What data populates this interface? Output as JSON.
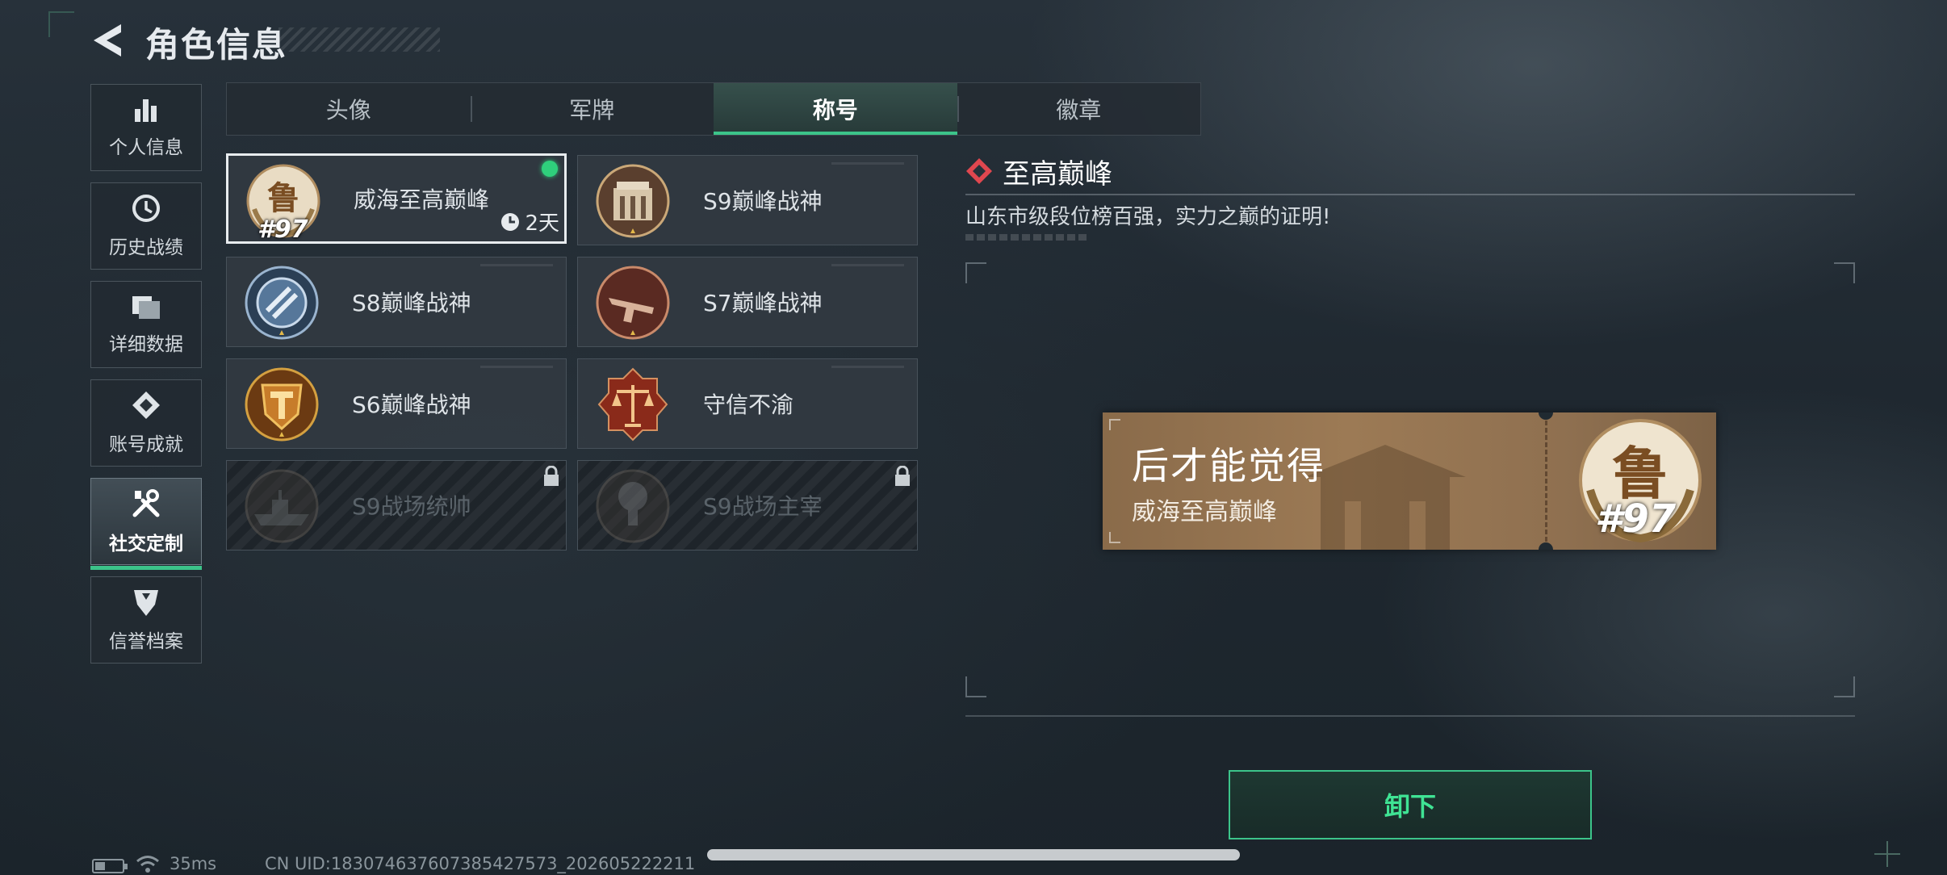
{
  "header": {
    "title": "角色信息"
  },
  "sidebar": {
    "items": [
      {
        "label": "个人信息",
        "icon": "bar-chart-icon",
        "active": false
      },
      {
        "label": "历史战绩",
        "icon": "history-clock-icon",
        "active": false
      },
      {
        "label": "详细数据",
        "icon": "folder-icon",
        "active": false
      },
      {
        "label": "账号成就",
        "icon": "achievement-icon",
        "active": false
      },
      {
        "label": "社交定制",
        "icon": "tools-icon",
        "active": true
      },
      {
        "label": "信誉档案",
        "icon": "credit-shield-icon",
        "active": false
      }
    ]
  },
  "tabs": [
    {
      "label": "头像",
      "active": false
    },
    {
      "label": "军牌",
      "active": false
    },
    {
      "label": "称号",
      "active": true
    },
    {
      "label": "徽章",
      "active": false
    }
  ],
  "titles": [
    {
      "name": "威海至高巅峰",
      "rank": "#97",
      "timer": "2天",
      "selected": true,
      "equipped": true,
      "locked": false,
      "emblem": "lu-emblem-icon"
    },
    {
      "name": "S9巅峰战神",
      "selected": false,
      "locked": false,
      "emblem": "s9-gate-emblem-icon"
    },
    {
      "name": "S8巅峰战神",
      "selected": false,
      "locked": false,
      "emblem": "s8-blue-emblem-icon"
    },
    {
      "name": "S7巅峰战神",
      "selected": false,
      "locked": false,
      "emblem": "s7-weapon-emblem-icon"
    },
    {
      "name": "S6巅峰战神",
      "selected": false,
      "locked": false,
      "emblem": "s6-shield-emblem-icon"
    },
    {
      "name": "守信不渝",
      "selected": false,
      "locked": false,
      "emblem": "scales-emblem-icon"
    },
    {
      "name": "S9战场统帅",
      "selected": false,
      "locked": true,
      "emblem": "warship-emblem-icon"
    },
    {
      "name": "S9战场主宰",
      "selected": false,
      "locked": true,
      "emblem": "explosion-emblem-icon"
    }
  ],
  "detail": {
    "title": "至高巅峰",
    "description": "山东市级段位榜百强，实力之巅的证明!",
    "preview": {
      "big_text": "后才能觉得",
      "small_text": "威海至高巅峰",
      "rank": "#97"
    },
    "action_label": "卸下"
  },
  "status": {
    "ping": "35ms",
    "uid": "CN UID:183074637607385427573_202605222211"
  },
  "colors": {
    "accent": "#3cc48a",
    "equipped_dot": "#2fd07c",
    "title_icon": "#e0474f"
  }
}
